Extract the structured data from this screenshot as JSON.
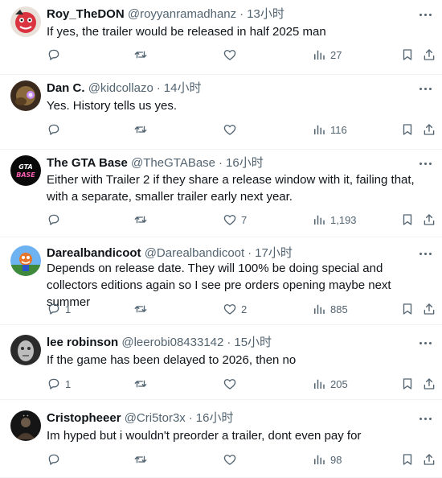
{
  "replies": [
    {
      "name": "Roy_TheDON",
      "handle": "@royyanramadhanz",
      "time": "13小时",
      "text": "If yes, the trailer would be released in half 2025 man",
      "replies": "",
      "reposts": "",
      "likes": "",
      "views": "27",
      "avatar_icon": "avatar-red-cartoon"
    },
    {
      "name": "Dan C.",
      "handle": "@kidcollazo",
      "time": "14小时",
      "text": "Yes. History tells us yes.",
      "replies": "",
      "reposts": "",
      "likes": "",
      "views": "116",
      "avatar_icon": "avatar-glow"
    },
    {
      "name": "The GTA Base",
      "handle": "@TheGTABase",
      "time": "16小时",
      "text": "Either with Trailer 2 if they share a release window with it, failing that, with a separate, smaller trailer early next year.",
      "replies": "",
      "reposts": "",
      "likes": "7",
      "views": "1,193",
      "avatar_icon": "avatar-gta-logo"
    },
    {
      "name": "Darealbandicoot",
      "handle": "@Darealbandicoot",
      "time": "17小时",
      "text": "Depends on release date. They will 100% be doing special and collectors editions again so I see pre orders opening maybe next summer",
      "replies": "1",
      "reposts": "",
      "likes": "2",
      "views": "885",
      "avatar_icon": "avatar-bandicoot"
    },
    {
      "name": "lee robinson",
      "handle": "@leerobi08433142",
      "time": "15小时",
      "text": "If the game has been delayed to 2026, then no",
      "replies": "1",
      "reposts": "",
      "likes": "",
      "views": "205",
      "avatar_icon": "avatar-gray-face"
    },
    {
      "name": "Cristopheeer",
      "handle": "@Cri5tor3x",
      "time": "16小时",
      "text": "Im hyped but i wouldn't preorder a trailer, dont even pay for",
      "replies": "",
      "reposts": "",
      "likes": "",
      "views": "98",
      "avatar_icon": "avatar-dark-figure"
    }
  ],
  "separator": "·",
  "colors": {
    "text": "#0f1419",
    "secondary": "#536471",
    "divider": "#eff3f4"
  }
}
